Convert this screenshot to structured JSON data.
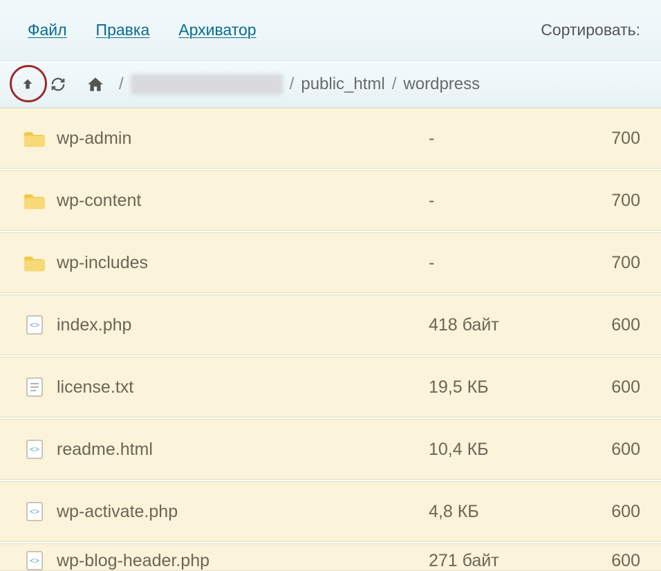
{
  "menu": {
    "file": "Файл",
    "edit": "Правка",
    "archiver": "Архиватор",
    "sort_label": "Сортировать:"
  },
  "breadcrumb": {
    "seg1": "public_html",
    "seg2": "wordpress"
  },
  "rows": [
    {
      "name": "wp-admin",
      "size": "-",
      "perm": "700",
      "type": "folder"
    },
    {
      "name": "wp-content",
      "size": "-",
      "perm": "700",
      "type": "folder"
    },
    {
      "name": "wp-includes",
      "size": "-",
      "perm": "700",
      "type": "folder"
    },
    {
      "name": "index.php",
      "size": "418 байт",
      "perm": "600",
      "type": "php"
    },
    {
      "name": "license.txt",
      "size": "19,5 КБ",
      "perm": "600",
      "type": "txt"
    },
    {
      "name": "readme.html",
      "size": "10,4 КБ",
      "perm": "600",
      "type": "php"
    },
    {
      "name": "wp-activate.php",
      "size": "4,8 КБ",
      "perm": "600",
      "type": "php"
    },
    {
      "name": "wp-blog-header.php",
      "size": "271 байт",
      "perm": "600",
      "type": "php"
    }
  ]
}
